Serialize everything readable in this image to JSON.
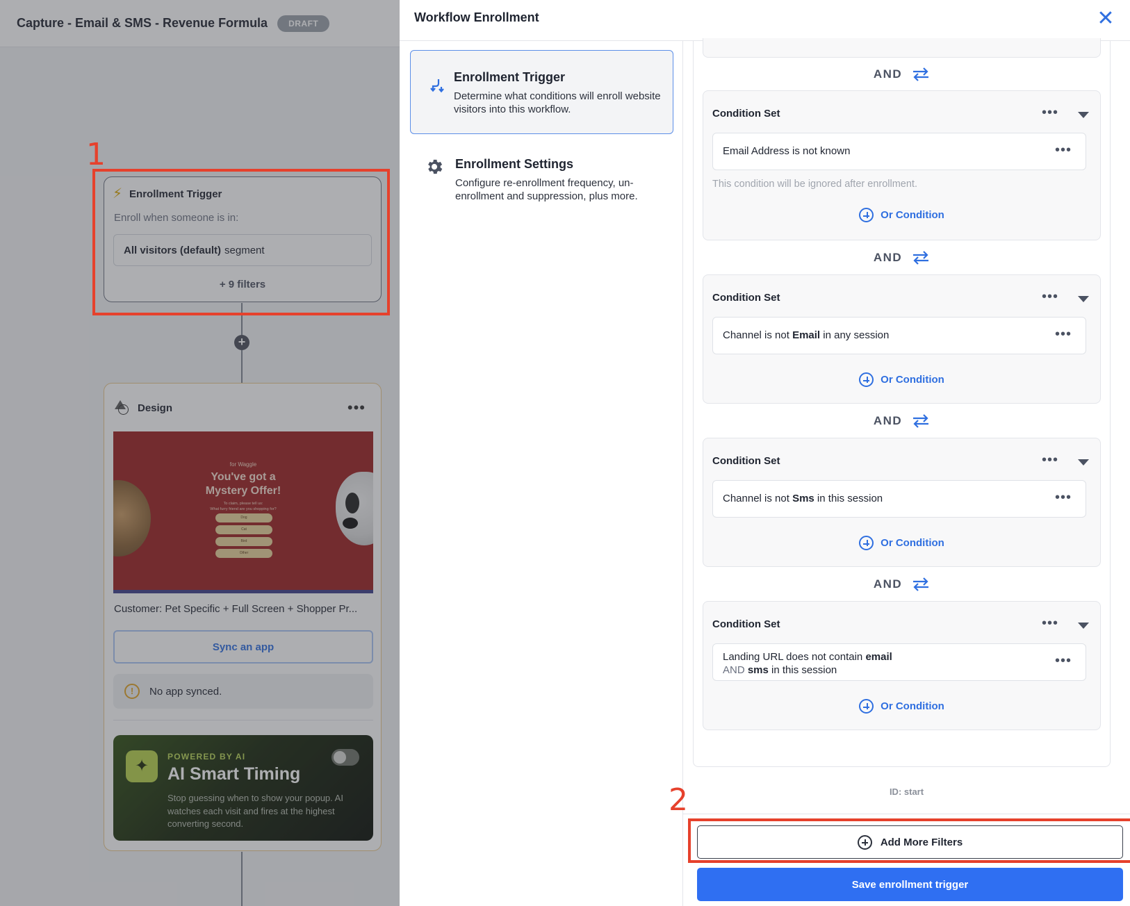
{
  "canvas": {
    "workflow_title": "Capture - Email & SMS - Revenue Formula",
    "status_badge": "DRAFT",
    "trigger_card": {
      "title": "Enrollment Trigger",
      "subtitle": "Enroll when someone is in:",
      "segment_name": "All visitors (default)",
      "segment_suffix": "segment",
      "filters_count": "+ 9 filters"
    },
    "design_card": {
      "title": "Design",
      "preview": {
        "brand": "for Waggle",
        "headline_line1": "You've got a",
        "headline_line2": "Mystery Offer!",
        "sub_line1": "To claim, please tell us:",
        "sub_line2": "What furry friend are you shopping for?",
        "options": [
          "Dog",
          "Cat",
          "Bird",
          "Other"
        ]
      },
      "design_name": "Customer: Pet Specific + Full Screen + Shopper Pr...",
      "sync_button": "Sync an app",
      "no_app_text": "No app synced.",
      "ai": {
        "powered_label": "POWERED BY AI",
        "title": "AI Smart Timing",
        "description": "Stop guessing when to show your popup. AI watches each visit and fires at the highest converting second.",
        "toggle_on": false
      }
    },
    "annotation_1": "1"
  },
  "drawer": {
    "title": "Workflow Enrollment",
    "nav": {
      "trigger": {
        "title": "Enrollment Trigger",
        "description": "Determine what conditions will enroll website visitors into this workflow."
      },
      "settings": {
        "title": "Enrollment Settings",
        "description": "Configure re-enrollment frequency, un-enrollment and suppression, plus more."
      }
    },
    "and_label": "AND",
    "condition_set_title": "Condition Set",
    "or_condition_label": "Or Condition",
    "condition_sets": [
      {
        "condition_parts": [
          "Email Address is not known"
        ],
        "note": "This condition will be ignored after enrollment."
      },
      {
        "condition_parts": [
          "Channel is not ",
          "Email",
          " in any session"
        ]
      },
      {
        "condition_parts": [
          "Channel is not ",
          "Sms",
          " in this session"
        ]
      },
      {
        "condition_line1": [
          "Landing URL does not contain ",
          "email"
        ],
        "condition_line2": [
          "AND",
          " sms",
          " in this session"
        ]
      }
    ],
    "node_id": "ID: start",
    "add_filters_button": "Add More Filters",
    "save_button": "Save enrollment trigger",
    "annotation_2": "2"
  },
  "colors": {
    "accent_blue": "#2f6ff2",
    "annotation_red": "#e6412c",
    "trigger_bolt": "#d9a400"
  }
}
